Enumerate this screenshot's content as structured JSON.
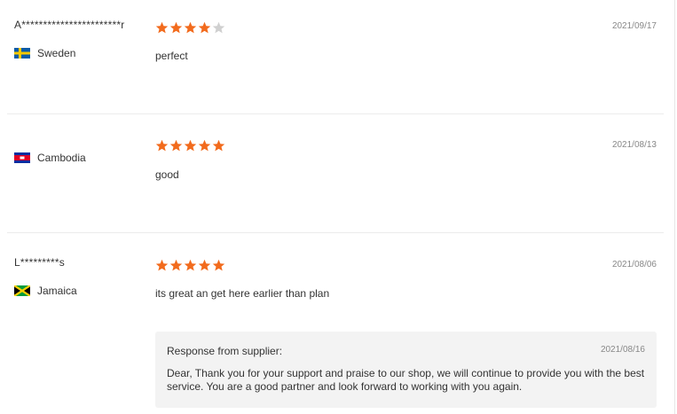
{
  "reviews": [
    {
      "username": "A***********************r",
      "country": "Sweden",
      "flag_icon": "sweden-flag-icon",
      "rating": 4,
      "date": "2021/09/17",
      "text": "perfect"
    },
    {
      "username": "",
      "country": "Cambodia",
      "flag_icon": "cambodia-flag-icon",
      "rating": 5,
      "date": "2021/08/13",
      "text": "good"
    },
    {
      "username": "L*********s",
      "country": "Jamaica",
      "flag_icon": "jamaica-flag-icon",
      "rating": 5,
      "date": "2021/08/06",
      "text": "its great an get here earlier than plan",
      "response": {
        "title": "Response from supplier:",
        "date": "2021/08/16",
        "body": "Dear, Thank you for your support and praise to our shop, we will continue to provide you with the best service. You are a good partner and look forward to working with you again."
      }
    }
  ],
  "colors": {
    "star_filled": "#f26b1d",
    "star_empty": "#d0d0d0",
    "response_bg": "#f3f3f3"
  },
  "rating_max": 5
}
